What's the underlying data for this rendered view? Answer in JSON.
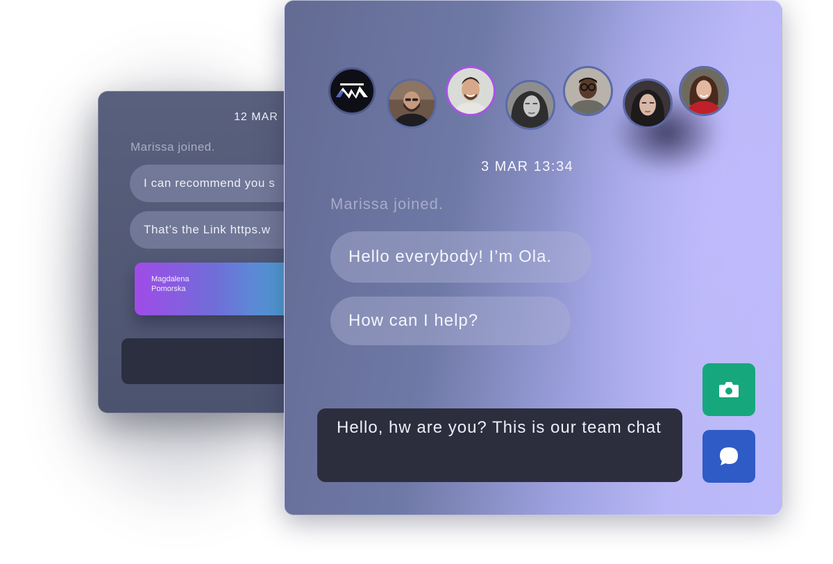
{
  "back_panel": {
    "date": "12 MAR",
    "joined_text": "Marissa joined.",
    "messages": [
      "I can recommend you s",
      "That’s the Link https.w"
    ],
    "user_card_name": "Magdalena Pomorska"
  },
  "front_panel": {
    "participants": [
      "team-logo",
      "man-beard",
      "smiling-man",
      "woman-bw",
      "man-glasses",
      "woman-dark-hair",
      "woman-red"
    ],
    "date": "3 MAR 13:34",
    "joined_text": "Marissa joined.",
    "messages": [
      "Hello everybody! I’m Ola.",
      "How can I help?"
    ],
    "input_value": "Hello, hw are you? This is our team chat",
    "buttons": {
      "camera_icon": "camera-icon",
      "chat_icon": "chat-bubble-icon"
    }
  },
  "colors": {
    "camera_button": "#17a77c",
    "chat_button": "#2f5bc6",
    "active_avatar_ring": "#a753e6",
    "user_card_gradient": [
      "#a04be8",
      "#3fb6d4"
    ]
  }
}
